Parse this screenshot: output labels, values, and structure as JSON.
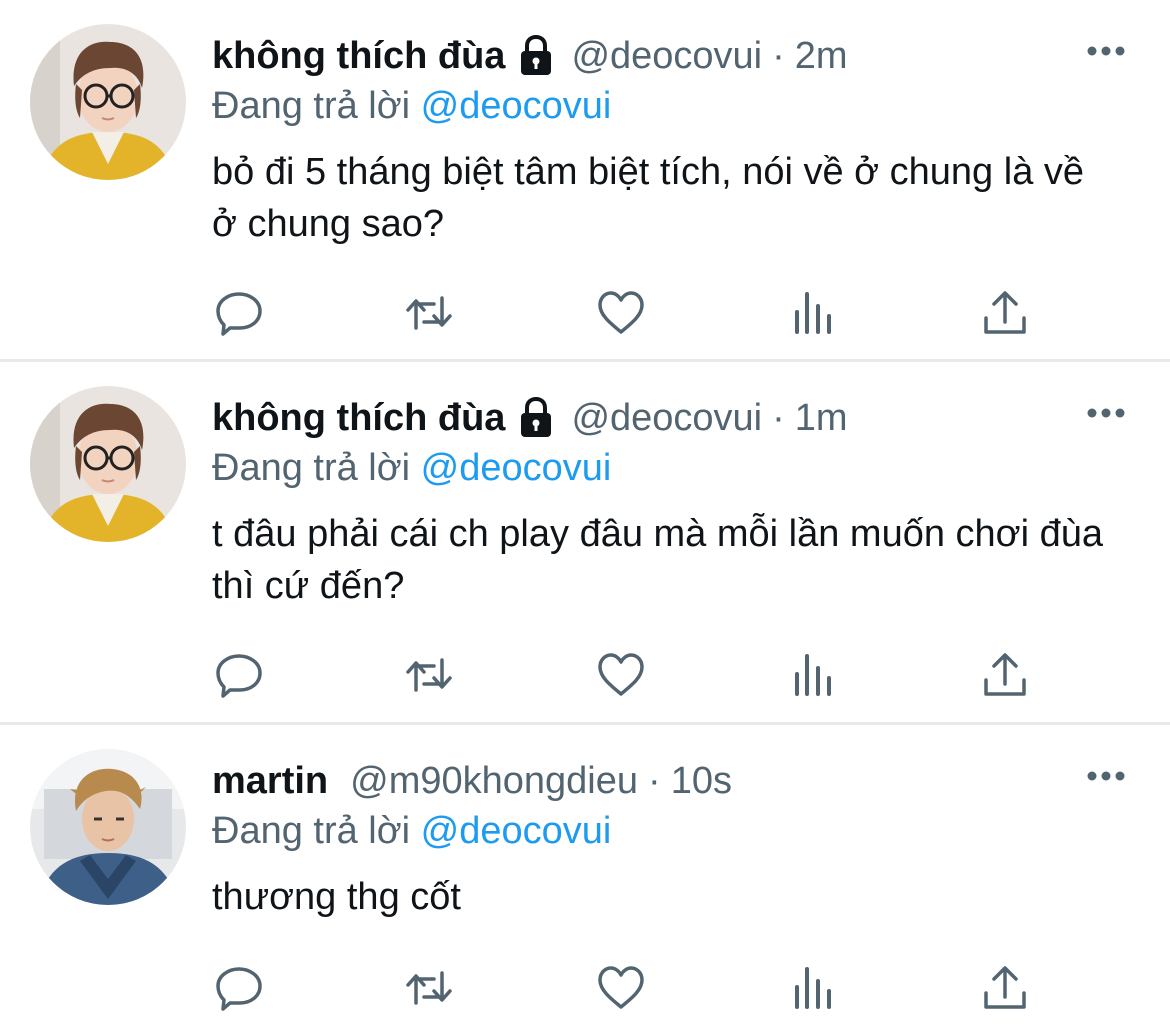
{
  "tweets": [
    {
      "display_name": "không thích đùa",
      "protected": true,
      "handle": "@deocovui",
      "separator": "·",
      "time": "2m",
      "reply_prefix": "Đang trả lời",
      "reply_to": "@deocovui",
      "text": "bỏ đi 5 tháng biệt tâm biệt tích, nói về ở chung là về ở chung sao?",
      "avatar": "yellow-jacket-glasses-avatar"
    },
    {
      "display_name": "không thích đùa",
      "protected": true,
      "handle": "@deocovui",
      "separator": "·",
      "time": "1m",
      "reply_prefix": "Đang trả lời",
      "reply_to": "@deocovui",
      "text": "t đâu phải cái ch play đâu mà mỗi lần muốn chơi đùa thì cứ đến?",
      "avatar": "yellow-jacket-glasses-avatar"
    },
    {
      "display_name": "martin",
      "protected": false,
      "handle": "@m90khongdieu",
      "separator": "·",
      "time": "10s",
      "reply_prefix": "Đang trả lời",
      "reply_to": "@deocovui",
      "text": "thương thg cốt",
      "avatar": "denim-jacket-blond-avatar"
    }
  ],
  "icons": {
    "reply": "reply-icon",
    "retweet": "retweet-icon",
    "like": "like-icon",
    "analytics": "analytics-icon",
    "share": "share-icon",
    "more": "more-icon",
    "lock": "lock-icon"
  },
  "colors": {
    "text": "#0f1419",
    "secondary": "#536471",
    "link": "#1d9bf0",
    "divider": "#e7e9ea"
  }
}
